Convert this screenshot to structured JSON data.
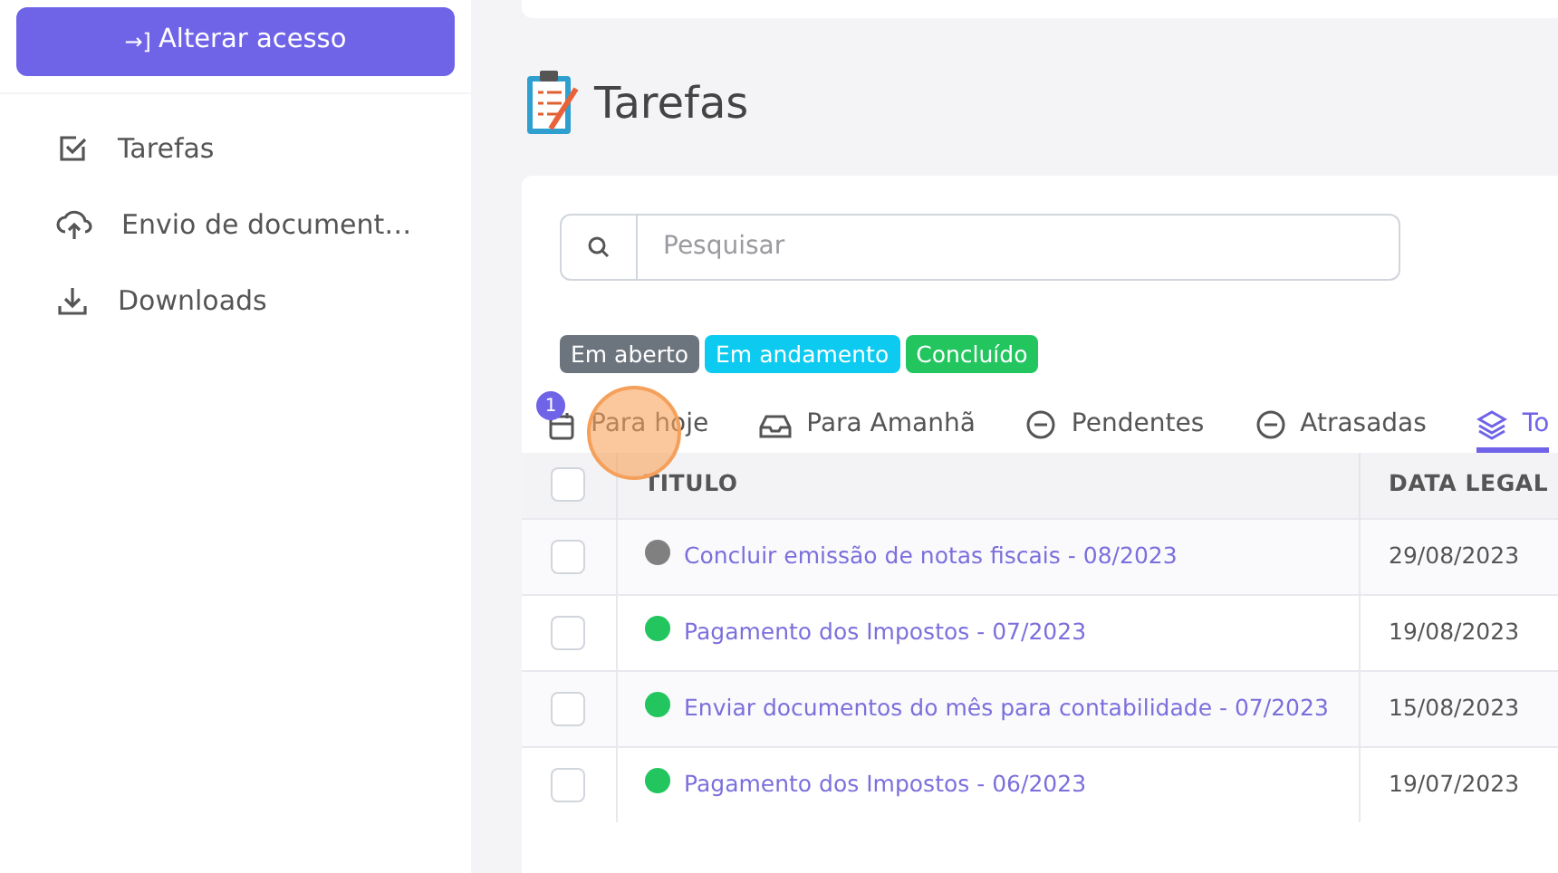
{
  "sidebar": {
    "access_button": {
      "icon": "→]",
      "label": "Alterar acesso"
    },
    "items": [
      {
        "label": "Tarefas",
        "kind": "checkbox",
        "selected": false
      },
      {
        "label": "Envio de document…",
        "kind": "upload",
        "selected": false
      },
      {
        "label": "Downloads",
        "kind": "download",
        "selected": false
      }
    ]
  },
  "page": {
    "title": "Tarefas"
  },
  "search": {
    "placeholder": "Pesquisar"
  },
  "status_badges": [
    {
      "label": "Em aberto",
      "color": "#6c757d"
    },
    {
      "label": "Em andamento",
      "color": "#0dcaf0"
    },
    {
      "label": "Concluído",
      "color": "#22c55e"
    }
  ],
  "tabs": [
    {
      "label": "Para hoje",
      "kind": "calendar",
      "selected": false,
      "count": "1"
    },
    {
      "label": "Para Amanhã",
      "kind": "inbox",
      "selected": false
    },
    {
      "label": "Pendentes",
      "kind": "pending",
      "selected": false
    },
    {
      "label": "Atrasadas",
      "kind": "overdue",
      "selected": false
    },
    {
      "label": "To",
      "kind": "all",
      "selected": true
    }
  ],
  "table": {
    "select_all_checked": false,
    "columns": [
      "TITULO",
      "DATA LEGAL"
    ],
    "rows": [
      {
        "checked": false,
        "color": "#808080",
        "title": "Concluir emissão de notas fiscais - 08/2023",
        "date": "29/08/2023"
      },
      {
        "checked": false,
        "color": "#22c55e",
        "title": "Pagamento dos Impostos - 07/2023",
        "date": "19/08/2023"
      },
      {
        "checked": false,
        "color": "#22c55e",
        "title": "Enviar documentos do mês para contabilidade - 07/2023",
        "date": "15/08/2023"
      },
      {
        "checked": false,
        "color": "#22c55e",
        "title": "Pagamento dos Impostos - 06/2023",
        "date": "19/07/2023"
      }
    ]
  }
}
